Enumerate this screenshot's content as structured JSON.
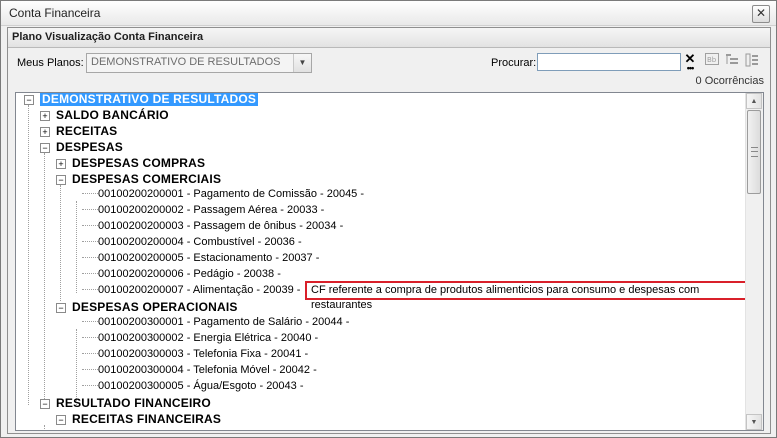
{
  "window": {
    "title": "Conta Financeira",
    "close_label": "✕"
  },
  "panel": {
    "title": "Plano Visualização Conta Financeira"
  },
  "plans": {
    "label": "Meus Planos:",
    "selected": "DEMONSTRATIVO DE RESULTADOS"
  },
  "search": {
    "label": "Procurar:",
    "value": "",
    "clear_label": "✕"
  },
  "occurrences": "0 Ocorrências",
  "tree": {
    "root": "DEMONSTRATIVO DE RESULTADOS",
    "saldo": "SALDO BANCÁRIO",
    "receitas": "RECEITAS",
    "despesas": "DESPESAS",
    "despesas_compras": "DESPESAS COMPRAS",
    "despesas_comerciais": "DESPESAS COMERCIAIS",
    "comerciais_items": [
      "00100200200001 - Pagamento de Comissão  -  20045  -",
      "00100200200002 - Passagem Aérea  -  20033  -",
      "00100200200003 - Passagem de ônibus  -  20034  -",
      "00100200200004 - Combustível  -  20036  -",
      "00100200200005 - Estacionamento  -  20037  -",
      "00100200200006 - Pedágio  -  20038  -",
      "00100200200007 - Alimentação  -  20039  -"
    ],
    "despesas_operacionais": "DESPESAS OPERACIONAIS",
    "operacionais_items": [
      "00100200300001 - Pagamento de Salário  -  20044  -",
      "00100200300002 - Energia Elétrica  -  20040  -",
      "00100200300003 - Telefonia Fixa  -  20041  -",
      "00100200300004 - Telefonia Móvel  -  20042  -",
      "00100200300005 - Água/Esgoto  -  20043  -"
    ],
    "resultado_financeiro": "RESULTADO FINANCEIRO",
    "receitas_financeiras": "RECEITAS FINANCEIRAS"
  },
  "tooltip": "CF referente a compra de produtos alimenticios para consumo e despesas com restaurantes"
}
